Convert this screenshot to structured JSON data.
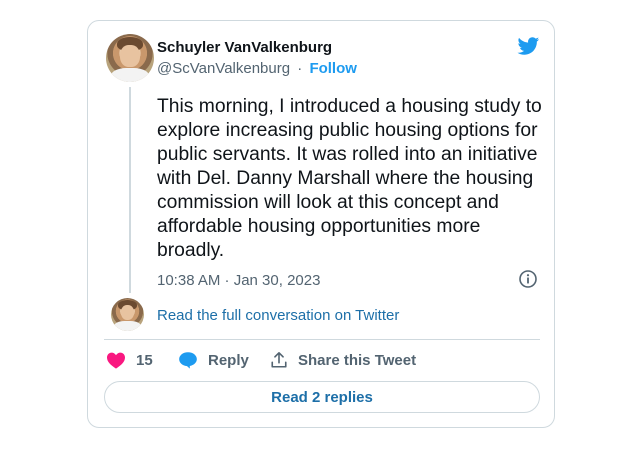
{
  "author": {
    "name": "Schuyler VanValkenburg",
    "handle": "@ScVanValkenburg",
    "separator": "·",
    "follow_label": "Follow"
  },
  "tweet": {
    "text": "This morning, I introduced a housing study to explore increasing public housing options for public servants. It was rolled into an initiative with Del. Danny Marshall where the housing commission will look at this concept and affordable housing opportunities more broadly.",
    "timestamp": "10:38 AM · Jan 30, 2023"
  },
  "conversation_link": "Read the full conversation on Twitter",
  "actions": {
    "likes_count": "15",
    "reply_label": "Reply",
    "share_label": "Share this Tweet"
  },
  "read_replies_label": "Read 2 replies",
  "icons": {
    "brand": "twitter-bird-icon",
    "info": "info-icon",
    "like": "heart-icon",
    "reply": "reply-bubble-icon",
    "share": "share-icon"
  },
  "colors": {
    "twitter_blue": "#1d9bf0",
    "link_blue": "#1d6fa8",
    "like_red": "#f91880",
    "secondary_text": "#536471",
    "border": "#cfd9de"
  }
}
